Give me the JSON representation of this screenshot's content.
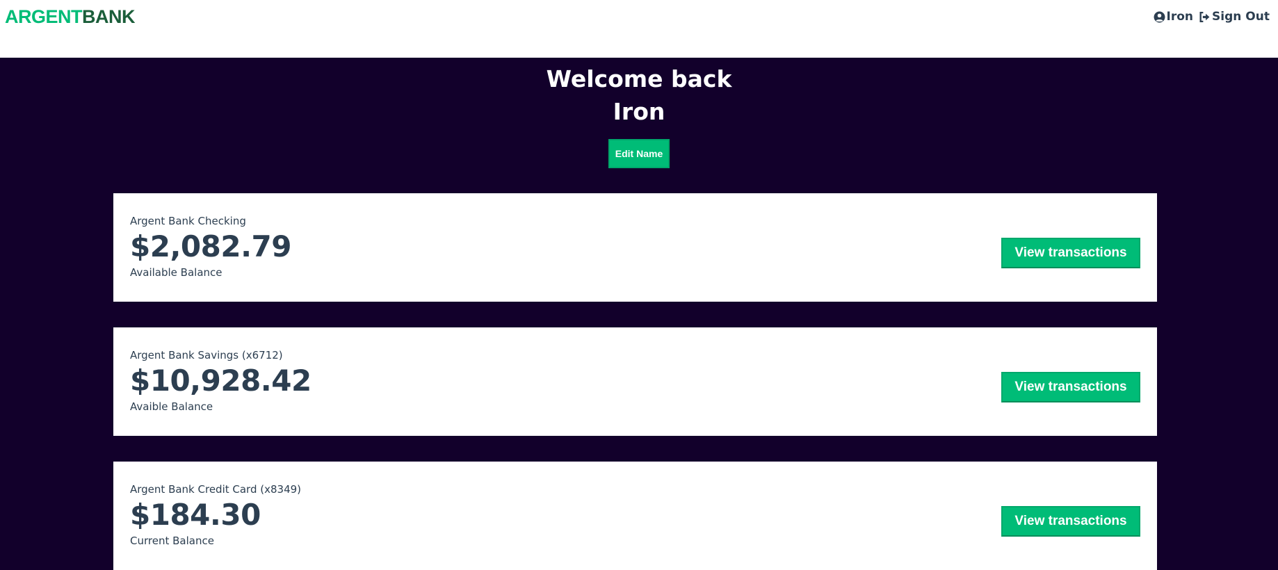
{
  "brand": {
    "part1": "ARGENT",
    "part2": "BANK"
  },
  "nav": {
    "user_label": "Iron",
    "user_icon": "user-circle-icon",
    "signout_label": "Sign Out",
    "signout_icon": "sign-out-icon"
  },
  "header": {
    "welcome": "Welcome back",
    "name": "Iron",
    "edit_button": "Edit Name"
  },
  "accounts": [
    {
      "title": "Argent Bank Checking",
      "amount": "$2,082.79",
      "description": "Available Balance",
      "button": "View transactions"
    },
    {
      "title": "Argent Bank Savings (x6712)",
      "amount": "$10,928.42",
      "description": "Avaible Balance",
      "button": "View transactions"
    },
    {
      "title": "Argent Bank Credit Card (x8349)",
      "amount": "$184.30",
      "description": "Current Balance",
      "button": "View transactions"
    }
  ],
  "colors": {
    "accent": "#00bc77",
    "background": "#12002b",
    "text": "#2c3e50"
  }
}
